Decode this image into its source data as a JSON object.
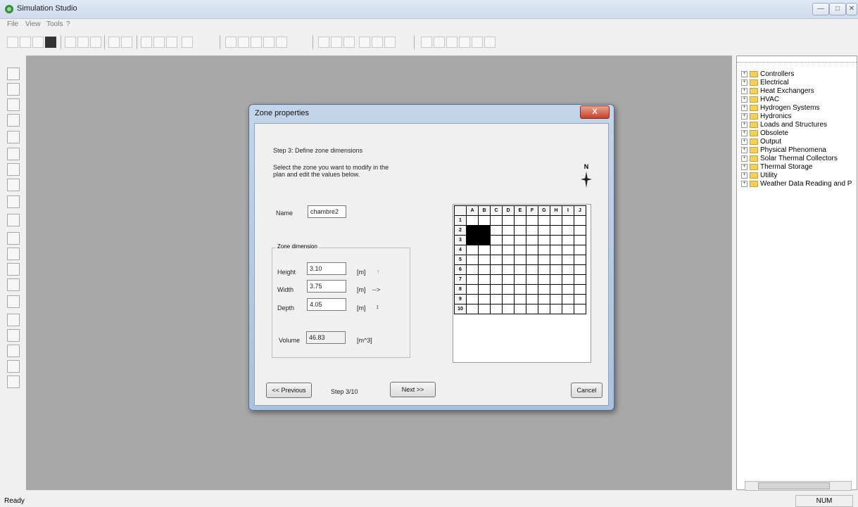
{
  "window": {
    "title": "Simulation Studio",
    "controls": [
      "—",
      "□",
      "✕"
    ]
  },
  "menu": [
    "File",
    "View",
    "Tools",
    "?"
  ],
  "status": {
    "left": "Ready",
    "right": "NUM"
  },
  "tree": {
    "items": [
      "Controllers",
      "Electrical",
      "Heat Exchangers",
      "HVAC",
      "Hydrogen Systems",
      "Hydronics",
      "Loads and Structures",
      "Obsolete",
      "Output",
      "Physical Phenomena",
      "Solar Thermal Collectors",
      "Thermal Storage",
      "Utility",
      "Weather Data Reading and P"
    ]
  },
  "dialog": {
    "title": "Zone properties",
    "close_label": "X",
    "step_title": "Step 3: Define zone dimensions",
    "instructions_line1": "Select the zone you want to modify in the",
    "instructions_line2": "plan and edit the values below.",
    "name_label": "Name",
    "name_value": "chambre2",
    "group_label": "Zone dimension",
    "height_label": "Height",
    "height_value": "3.10",
    "height_unit": "[m]",
    "height_arrow": "↑",
    "width_label": "Width",
    "width_value": "3.75",
    "width_unit": "[m]",
    "width_arrow": "-->",
    "depth_label": "Depth",
    "depth_value": "4.05",
    "depth_unit": "[m]",
    "depth_arrow": "↕",
    "volume_label": "Volume",
    "volume_value": "46.83",
    "volume_unit": "[m^3]",
    "compass_label": "N",
    "grid": {
      "columns": [
        "A",
        "B",
        "C",
        "D",
        "E",
        "F",
        "G",
        "H",
        "I",
        "J"
      ],
      "rows": [
        "1",
        "2",
        "3",
        "4",
        "5",
        "6",
        "7",
        "8",
        "9",
        "10"
      ],
      "filled": [
        [
          2,
          1
        ],
        [
          2,
          2
        ],
        [
          3,
          1
        ],
        [
          3,
          2
        ]
      ]
    },
    "prev_label": "<< Previous",
    "step_indicator": "Step 3/10",
    "next_label": "Next >>",
    "cancel_label": "Cancel"
  }
}
